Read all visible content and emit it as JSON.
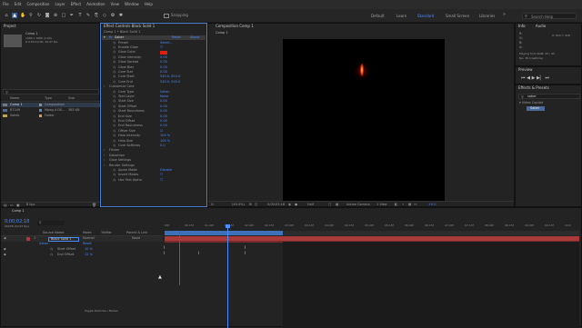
{
  "menu": [
    "File",
    "Edit",
    "Composition",
    "Layer",
    "Effect",
    "Animation",
    "View",
    "Window",
    "Help"
  ],
  "toolbar": {
    "snapping_label": "Snapping",
    "workspaces": [
      "Default",
      "Learn",
      "Standard",
      "Small Screen",
      "Libraries"
    ],
    "active_workspace": "Standard",
    "search_placeholder": "Search Help"
  },
  "project": {
    "title": "Project",
    "comp_name": "Comp 1",
    "comp_info_1": "1080 x 1080 (1.00)",
    "comp_info_2": "Δ 0;00;10;00, 29.97 fps",
    "search_icon": "search-icon",
    "columns": [
      "Name",
      "Type",
      "Size"
    ],
    "items": [
      {
        "name": "Comp 1",
        "type": "Composition",
        "size": "",
        "color": "#8c8c8c"
      },
      {
        "name": "87249",
        "type": "Mpeg-4 DS...",
        "size": "385 KB",
        "color": "#5a8bc4"
      },
      {
        "name": "Solids",
        "type": "Folder",
        "size": "",
        "color": "#d4a43a"
      }
    ],
    "bpc": "8 bpc"
  },
  "effect_controls": {
    "title": "Effect Controls Black Solid 1",
    "subtitle": "Comp 1 • Black Solid 1",
    "effect_name": "Saber",
    "reset_label": "Reset",
    "about_label": "About",
    "rows": [
      {
        "indent": 1,
        "label": "Preset",
        "value": "Select..."
      },
      {
        "indent": 1,
        "label": "Enable Glow",
        "value": "☐"
      },
      {
        "indent": 1,
        "label": "Glow Color",
        "value": "swatch"
      },
      {
        "indent": 1,
        "label": "Glow Intensity",
        "value": "0.00"
      },
      {
        "indent": 1,
        "label": "Glow Spread",
        "value": "0.00"
      },
      {
        "indent": 1,
        "label": "Glow Bias",
        "value": "0.00"
      },
      {
        "indent": 1,
        "label": "Core Size",
        "value": "0.00"
      },
      {
        "indent": 1,
        "label": "Core Start",
        "value": "540.0, 810.0"
      },
      {
        "indent": 1,
        "label": "Core End",
        "value": "540.0, 540.0"
      },
      {
        "indent": 0,
        "label": "Customize Core",
        "value": ""
      },
      {
        "indent": 1,
        "label": "Core Type",
        "value": "Saber"
      },
      {
        "indent": 1,
        "label": "Text Layer",
        "value": "None"
      },
      {
        "indent": 1,
        "label": "Start Size",
        "value": "0.00"
      },
      {
        "indent": 1,
        "label": "Start Offset",
        "value": "0.00"
      },
      {
        "indent": 1,
        "label": "Start Roundness",
        "value": "0.00"
      },
      {
        "indent": 1,
        "label": "End Size",
        "value": "0.00"
      },
      {
        "indent": 1,
        "label": "End Offset",
        "value": "0.00"
      },
      {
        "indent": 1,
        "label": "End Roundness",
        "value": "0.00"
      },
      {
        "indent": 1,
        "label": "Offset Size",
        "value": "☑"
      },
      {
        "indent": 1,
        "label": "Halo Intensity",
        "value": "100 %"
      },
      {
        "indent": 1,
        "label": "Halo Size",
        "value": "100 %"
      },
      {
        "indent": 1,
        "label": "Core Softness",
        "value": "0.0"
      },
      {
        "indent": 0,
        "label": "Flicker",
        "value": ""
      },
      {
        "indent": 0,
        "label": "Distortion",
        "value": ""
      },
      {
        "indent": 0,
        "label": "Glow Settings",
        "value": ""
      },
      {
        "indent": 0,
        "label": "Render Settings",
        "value": ""
      },
      {
        "indent": 1,
        "label": "Alpha Mode",
        "value": "Disable"
      },
      {
        "indent": 1,
        "label": "Invert Masks",
        "value": "☐"
      },
      {
        "indent": 1,
        "label": "Use Text Alpha",
        "value": "☐"
      }
    ],
    "glow_color": "#e02010"
  },
  "composition": {
    "title": "Composition Comp 1",
    "tab": "Comp 1",
    "zoom": "(49.4%)",
    "timecode": "0;00;02;18",
    "resolution": "Half",
    "camera": "Active Camera",
    "views": "1 View",
    "exposure": "+0.0"
  },
  "info": {
    "tabs": [
      "Info",
      "Audio"
    ],
    "rows": [
      "R:",
      "G:",
      "B:",
      "A:"
    ],
    "xy": "X: 616  Y: 418",
    "playing": "Playing from RAM: 45 / 45",
    "fps": "fps: 30 (realtime)"
  },
  "preview": {
    "title": "Preview"
  },
  "effects_presets": {
    "title": "Effects & Presets",
    "search_value": "saber",
    "category": "Video Copilot",
    "item": "Saber"
  },
  "timeline": {
    "tab": "Comp 1",
    "timecode": "0;00;02;18",
    "frame_info": "00078 (29.97 fps)",
    "col_source": "Source Name",
    "col_mode": "Mode",
    "col_trkmat": "TrkMat",
    "col_parent": "Parent & Link",
    "layer_num": "1",
    "layer_name": "Black Solid 1",
    "layer_mode": "Normal",
    "layer_parent": "None",
    "effect": "Saber",
    "reset": "Reset",
    "props": [
      {
        "name": "Start Offset",
        "value": "10 %"
      },
      {
        "name": "End Offset",
        "value": "12 %"
      }
    ],
    "ruler": [
      "00f",
      "00:15f",
      "01:00f",
      "01:15f",
      "02:00f",
      "02:15f",
      "03:00f",
      "03:15f",
      "04:00f",
      "04:15f",
      "05:00f",
      "05:15f",
      "06:00f",
      "06:15f",
      "07:00f",
      "07:15f",
      "08:00f",
      "08:15f",
      "09:00f",
      "09:15f",
      "10:0"
    ],
    "status": "Toggle Switches / Modes",
    "work_area_color": "#3d72b8",
    "layer_bar_color": "#b33535"
  }
}
